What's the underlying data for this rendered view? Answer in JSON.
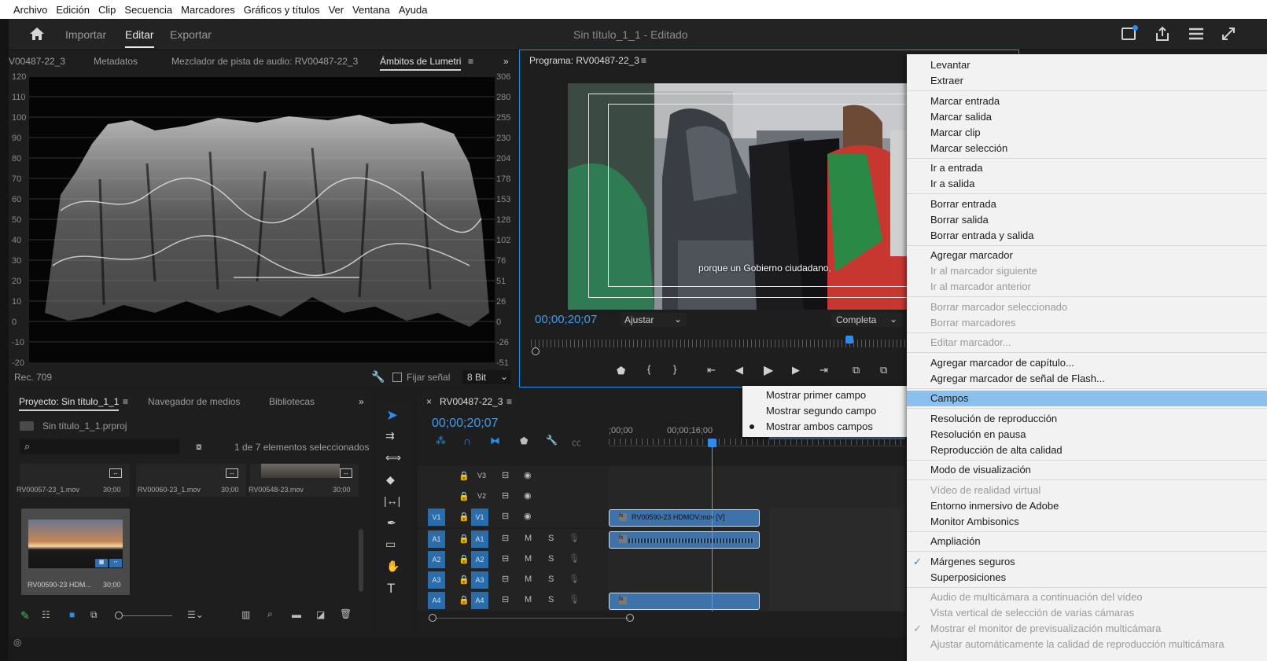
{
  "menubar": [
    "Archivo",
    "Edición",
    "Clip",
    "Secuencia",
    "Marcadores",
    "Gráficos y títulos",
    "Ver",
    "Ventana",
    "Ayuda"
  ],
  "workspace": {
    "import": "Importar",
    "edit": "Editar",
    "export": "Exportar",
    "title": "Sin título_1_1",
    "status": "- Editado"
  },
  "lumetri": {
    "tabs": [
      "V00487-22_3",
      "Metadatos",
      "Mezclador de pista de audio: RV00487-22_3",
      "Ámbitos de Lumetri"
    ],
    "left_scale": [
      "120",
      "110",
      "100",
      "90",
      "80",
      "70",
      "60",
      "50",
      "40",
      "30",
      "20",
      "10",
      "0",
      "-10",
      "-20"
    ],
    "right_scale": [
      "306",
      "280",
      "255",
      "230",
      "204",
      "178",
      "153",
      "128",
      "102",
      "76",
      "51",
      "26",
      "0",
      "-26",
      "-51"
    ],
    "rec": "Rec. 709",
    "clamp": "Fijar señal",
    "bits": "8 Bit"
  },
  "program": {
    "title": "Programa: RV00487-22_3",
    "caption": "porque un Gobierno ciudadano,",
    "timecode": "00;00;20;07",
    "fit": "Ajustar",
    "quality": "Completa"
  },
  "project": {
    "tabs": [
      "Proyecto: Sin título_1_1",
      "Navegador de medios",
      "Bibliotecas"
    ],
    "file": "Sin título_1_1.prproj",
    "selection": "1 de 7 elementos seleccionados",
    "items": [
      {
        "name": "RV00057-23_1.mov",
        "dur": "30;00"
      },
      {
        "name": "RV00060-23_1.mov",
        "dur": "30;00"
      },
      {
        "name": "RV00548-23.mov",
        "dur": "30;00"
      },
      {
        "name": "RV00590-23 HDM...",
        "dur": "30;00"
      }
    ]
  },
  "timeline": {
    "title": "RV00487-22_3",
    "timecode": "00;00;20;07",
    "ruler": [
      ";00;00",
      "00;00;16;00"
    ],
    "video_tracks": [
      {
        "src": "",
        "label": "V3"
      },
      {
        "src": "",
        "label": "V2"
      },
      {
        "src": "V1",
        "label": "V1"
      }
    ],
    "audio_tracks": [
      {
        "src": "A1",
        "label": "A1"
      },
      {
        "src": "A2",
        "label": "A2"
      },
      {
        "src": "A3",
        "label": "A3"
      },
      {
        "src": "A4",
        "label": "A4"
      }
    ],
    "mute": "M",
    "solo": "S",
    "clip_v1": "RV00590-23 HDMOV.mov [V]"
  },
  "fields_submenu": [
    "Mostrar primer campo",
    "Mostrar segundo campo",
    "Mostrar ambos campos"
  ],
  "fields_checked": "Mostrar ambos campos",
  "context_menu": [
    {
      "label": "Levantar",
      "disabled": false
    },
    {
      "label": "Extraer",
      "disabled": false
    },
    {
      "label": "Marcar entrada",
      "disabled": false
    },
    {
      "label": "Marcar salida",
      "disabled": false
    },
    {
      "label": "Marcar clip",
      "disabled": false
    },
    {
      "label": "Marcar selección",
      "disabled": false
    },
    {
      "label": "Ir a entrada",
      "disabled": false
    },
    {
      "label": "Ir a salida",
      "disabled": false
    },
    {
      "label": "Borrar entrada",
      "disabled": false
    },
    {
      "label": "Borrar salida",
      "disabled": false
    },
    {
      "label": "Borrar entrada y salida",
      "disabled": false
    },
    {
      "label": "Agregar marcador",
      "disabled": false
    },
    {
      "label": "Ir al marcador siguiente",
      "disabled": true
    },
    {
      "label": "Ir al marcador anterior",
      "disabled": true
    },
    {
      "label": "Borrar marcador seleccionado",
      "disabled": true
    },
    {
      "label": "Borrar marcadores",
      "disabled": true
    },
    {
      "label": "Editar marcador...",
      "disabled": true
    },
    {
      "label": "Agregar marcador de capítulo...",
      "disabled": false
    },
    {
      "label": "Agregar marcador de señal de Flash...",
      "disabled": false
    },
    {
      "label": "Campos",
      "disabled": false
    },
    {
      "label": "Resolución de reproducción",
      "disabled": false
    },
    {
      "label": "Resolución en pausa",
      "disabled": false
    },
    {
      "label": "Reproducción de alta calidad",
      "disabled": false
    },
    {
      "label": "Modo de visualización",
      "disabled": false
    },
    {
      "label": "Vídeo de realidad virtual",
      "disabled": true
    },
    {
      "label": "Entorno inmersivo de Adobe",
      "disabled": false
    },
    {
      "label": "Monitor Ambisonics",
      "disabled": false
    },
    {
      "label": "Ampliación",
      "disabled": false
    },
    {
      "label": "Márgenes seguros",
      "disabled": false
    },
    {
      "label": "Superposiciones",
      "disabled": false
    },
    {
      "label": "Audio de multicámara a continuación del vídeo",
      "disabled": true
    },
    {
      "label": "Vista vertical de selección de varias cámaras",
      "disabled": true
    },
    {
      "label": "Mostrar el monitor de previsualización multicámara",
      "disabled": true
    },
    {
      "label": "Ajustar automáticamente la calidad de reproducción multicámara",
      "disabled": true
    }
  ],
  "context_highlight": "Campos",
  "context_checked": [
    "Márgenes seguros",
    "Mostrar el monitor de previsualización multicámara"
  ],
  "colors": {
    "accent": "#2d8ceb",
    "highlight": "#8bc0ee",
    "track_blue": "#2b6ca9",
    "clip_blue": "#3f72a8"
  }
}
